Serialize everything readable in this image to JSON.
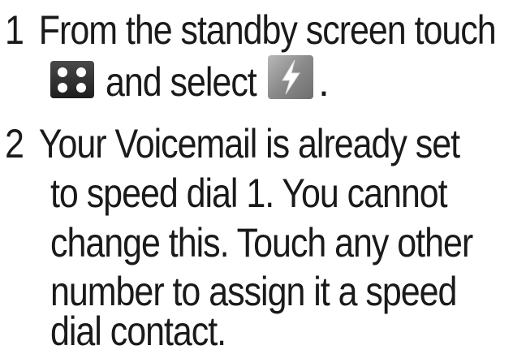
{
  "steps": [
    {
      "number": "1",
      "lines": [
        "From the standby screen touch",
        "and select",
        "."
      ],
      "icons": [
        "menu-grid-icon",
        "speed-dial-bolt-icon"
      ]
    },
    {
      "number": "2",
      "lines": [
        "Your Voicemail is already set",
        "to speed dial 1. You cannot",
        "change this. Touch any other",
        "number to assign it a speed",
        "dial contact."
      ]
    }
  ]
}
